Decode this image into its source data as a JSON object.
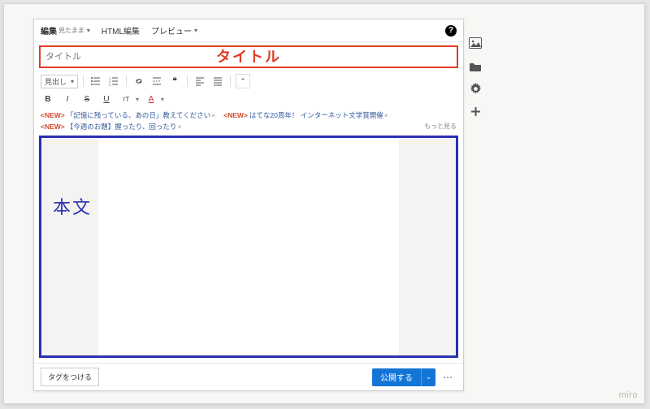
{
  "tabs": {
    "edit_label": "編集",
    "edit_sub": "見たまま",
    "html_label": "HTML編集",
    "preview_label": "プレビュー"
  },
  "title": {
    "placeholder": "タイトル",
    "annot": "タイトル"
  },
  "toolbar": {
    "heading_select": "見出し"
  },
  "topics": {
    "items": [
      {
        "text": "「記憶に残っている、あの日」教えてください"
      },
      {
        "text": "はてな20周年！ インターネット文学賞開催"
      },
      {
        "text": "【今週のお題】握ったり、回ったり"
      }
    ],
    "more": "もっと見る",
    "new_prefix": "<NEW>"
  },
  "body": {
    "annot": "本文"
  },
  "bottom": {
    "tag_label": "タグをつける",
    "publish_label": "公開する"
  },
  "watermark": "miro",
  "colors": {
    "title_frame": "#de3c22",
    "body_frame": "#2b2fb3",
    "publish": "#1375d6"
  }
}
